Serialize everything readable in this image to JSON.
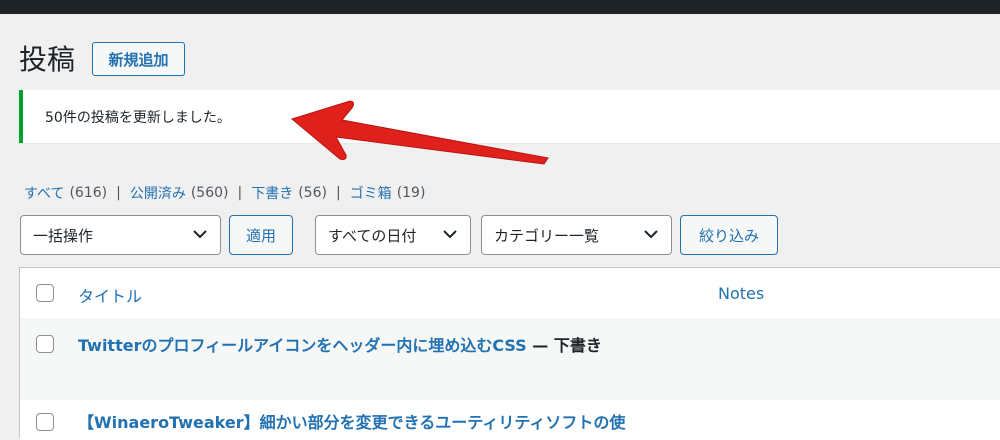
{
  "page": {
    "title": "投稿",
    "add_new_label": "新規追加"
  },
  "notice": {
    "message": "50件の投稿を更新しました。",
    "color": "#00a32a"
  },
  "annotation": {
    "arrow_color": "#e0201b"
  },
  "filters": {
    "status_links": [
      {
        "label": "すべて",
        "count": "(616)"
      },
      {
        "label": "公開済み",
        "count": "(560)"
      },
      {
        "label": "下書き",
        "count": "(56)"
      },
      {
        "label": "ゴミ箱",
        "count": "(19)"
      }
    ],
    "separator": "|",
    "bulk_action_selected": "一括操作",
    "apply_label": "適用",
    "date_selected": "すべての日付",
    "category_selected": "カテゴリー一覧",
    "filter_label": "絞り込み"
  },
  "table": {
    "columns": {
      "title": "タイトル",
      "notes": "Notes"
    },
    "rows": [
      {
        "title": "Twitterのプロフィールアイコンをヘッダー内に埋め込むCSS",
        "state": " — 下書き"
      },
      {
        "title": "【WinaeroTweaker】細かい部分を変更できるユーティリティソフトの使",
        "state": ""
      }
    ]
  },
  "colors": {
    "accent": "#2271b1",
    "adminbar": "#1d2327",
    "background": "#f0f0f1"
  }
}
